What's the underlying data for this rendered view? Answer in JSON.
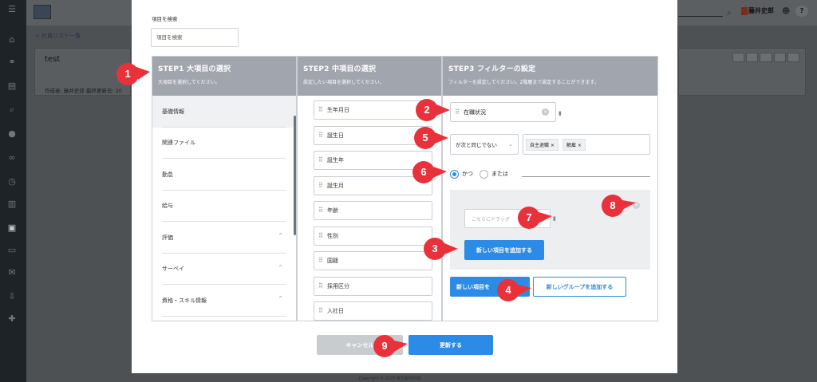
{
  "background": {
    "user_name": "藤井史郎",
    "back_link": "< 社員リスト一覧",
    "card_title": "test",
    "meta": "作成者: 藤井史郎  最終更新日: 20",
    "help": "?",
    "footer": "Copyright © 2023 株式会社RISE"
  },
  "search": {
    "label": "項目を検索",
    "placeholder": "項目を検索"
  },
  "step1": {
    "title": "STEP1 大項目の選択",
    "subtitle": "大項目を選択してください。",
    "categories": [
      {
        "label": "基礎情報"
      },
      {
        "label": "関連ファイル"
      },
      {
        "label": "勤怠"
      },
      {
        "label": "給与"
      },
      {
        "label": "評価"
      },
      {
        "label": "サーベイ"
      },
      {
        "label": "資格・スキル情報"
      }
    ]
  },
  "step2": {
    "title": "STEP2 中項目の選択",
    "subtitle": "設定したい項目を選択してください。",
    "items": [
      {
        "label": "生年月日"
      },
      {
        "label": "誕生日"
      },
      {
        "label": "誕生年"
      },
      {
        "label": "誕生月"
      },
      {
        "label": "年齢"
      },
      {
        "label": "性別"
      },
      {
        "label": "国籍"
      },
      {
        "label": "採用区分"
      },
      {
        "label": "入社日"
      }
    ]
  },
  "step3": {
    "title": "STEP3 フィルターの設定",
    "subtitle": "フィルターを設定してください。2階層まで設定することができます。",
    "filter_item": "在職状況",
    "condition": "が次と同じでない",
    "tags": [
      "自主退職 ×",
      "解雇 ×"
    ],
    "radio_and": "かつ",
    "radio_or": "または",
    "drop_placeholder": "こちらにドラッグ",
    "add_item_label": "新しい項目を追加する",
    "add_item_label_2": "新しい項目を",
    "add_group_label": "新しいグループを追加する"
  },
  "footer_buttons": {
    "cancel": "キャンセル",
    "update": "更新する"
  },
  "annotations": [
    "1",
    "2",
    "3",
    "4",
    "5",
    "6",
    "7",
    "8",
    "9"
  ],
  "colors": {
    "accent": "#2b8be6",
    "header": "#a1a5ad",
    "marker": "#e8313b"
  }
}
